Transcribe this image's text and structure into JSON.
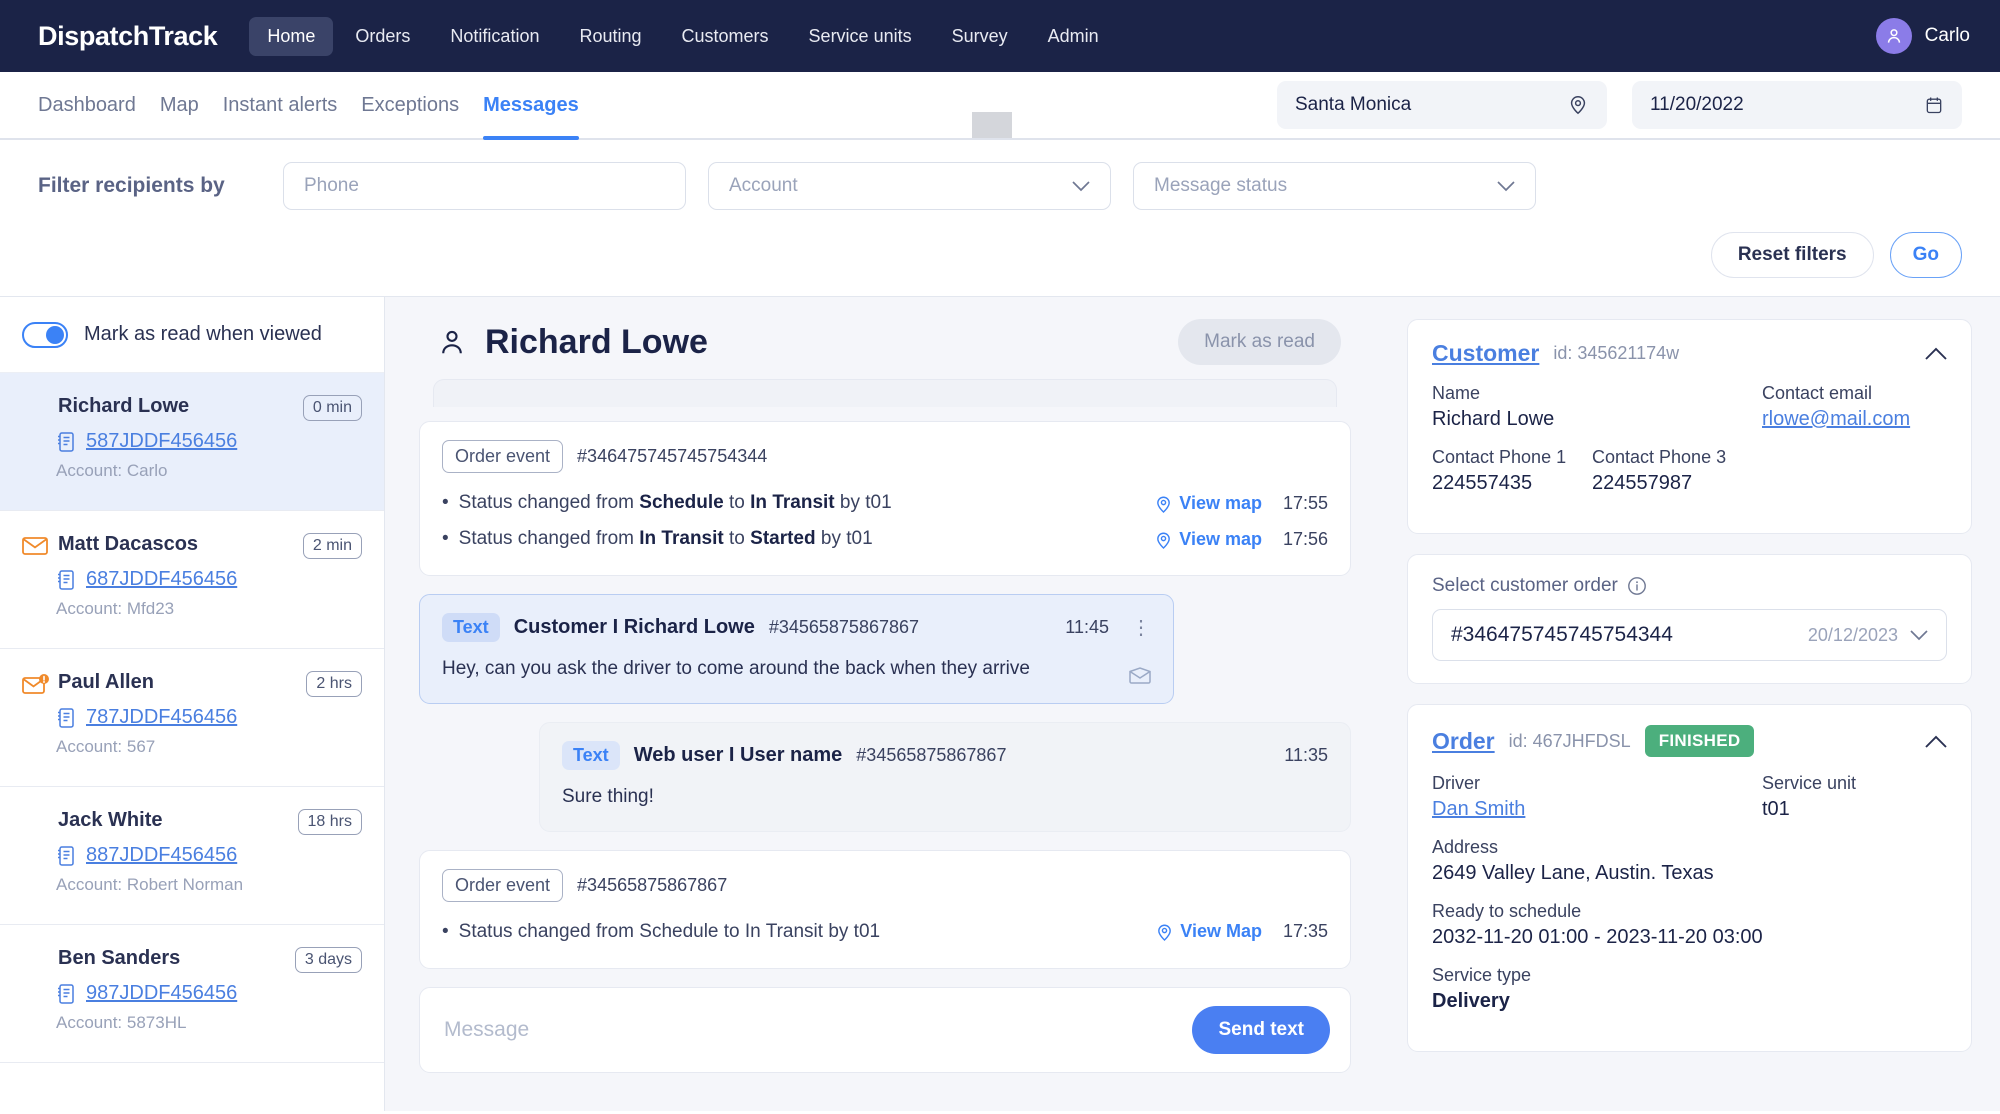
{
  "topnav": {
    "brand": "DispatchTrack",
    "links": [
      {
        "label": "Home",
        "active": true
      },
      {
        "label": "Orders",
        "active": false
      },
      {
        "label": "Notification",
        "active": false
      },
      {
        "label": "Routing",
        "active": false
      },
      {
        "label": "Customers",
        "active": false
      },
      {
        "label": "Service units",
        "active": false
      },
      {
        "label": "Survey",
        "active": false
      },
      {
        "label": "Admin",
        "active": false
      }
    ],
    "user": "Carlo"
  },
  "subnav": {
    "links": [
      {
        "label": "Dashboard",
        "active": false
      },
      {
        "label": "Map",
        "active": false
      },
      {
        "label": "Instant alerts",
        "active": false
      },
      {
        "label": "Exceptions",
        "active": false
      },
      {
        "label": "Messages",
        "active": true
      }
    ],
    "location_value": "Santa Monica",
    "date_value": "11/20/2022"
  },
  "filters": {
    "label": "Filter recipients by",
    "phone_placeholder": "Phone",
    "account_placeholder": "Account",
    "status_placeholder": "Message status",
    "reset_label": "Reset filters",
    "go_label": "Go"
  },
  "sidebar": {
    "mark_as_read_toggle_label": "Mark as read when viewed",
    "conversations": [
      {
        "name": "Richard Lowe",
        "time": "0 min",
        "order": "587JDDF456456",
        "account": "Account: Carlo",
        "selected": true,
        "icon": "none"
      },
      {
        "name": "Matt Dacascos",
        "time": "2 min",
        "order": "687JDDF456456",
        "account": "Account: Mfd23",
        "selected": false,
        "icon": "envelope"
      },
      {
        "name": "Paul Allen",
        "time": "2 hrs",
        "order": "787JDDF456456",
        "account": "Account: 567",
        "selected": false,
        "icon": "envelope-alert"
      },
      {
        "name": "Jack White",
        "time": "18 hrs",
        "order": "887JDDF456456",
        "account": "Account: Robert Norman",
        "selected": false,
        "icon": "none"
      },
      {
        "name": "Ben Sanders",
        "time": "3 days",
        "order": "987JDDF456456",
        "account": "Account: 5873HL",
        "selected": false,
        "icon": "none"
      }
    ]
  },
  "thread": {
    "title": "Richard Lowe",
    "mark_as_read_label": "Mark as read",
    "event1": {
      "badge": "Order event",
      "order_id": "#346475745745754344",
      "lines": [
        {
          "prefix": "Status changed from ",
          "from": "Schedule",
          "mid": " to ",
          "to": "In Transit",
          "suffix": " by t01",
          "bold": true,
          "link": "View map",
          "time": "17:55"
        },
        {
          "prefix": "Status changed from ",
          "from": "In Transit",
          "mid": " to ",
          "to": "Started",
          "suffix": " by t01",
          "bold": true,
          "link": "View map",
          "time": "17:56"
        }
      ]
    },
    "message_in": {
      "tag": "Text",
      "from": "Customer  I  Richard Lowe",
      "id": "#34565875867867",
      "time": "11:45",
      "body": "Hey, can you ask the driver to come around the back when they arrive"
    },
    "message_out": {
      "tag": "Text",
      "from": "Web user  I  User name",
      "id": "#34565875867867",
      "time": "11:35",
      "body": "Sure thing!"
    },
    "event2": {
      "badge": "Order event",
      "order_id": "#34565875867867",
      "lines": [
        {
          "prefix": "Status changed from ",
          "from": "Schedule",
          "mid": " to ",
          "to": "In Transit",
          "suffix": " by t01",
          "bold": false,
          "link": "View Map",
          "time": "17:35"
        }
      ]
    },
    "composer_placeholder": "Message",
    "send_label": "Send text"
  },
  "customer_panel": {
    "title": "Customer",
    "id": "id: 345621174w",
    "name_label": "Name",
    "name_value": "Richard Lowe",
    "email_label": "Contact email",
    "email_value": "rlowe@mail.com",
    "phone1_label": "Contact Phone 1",
    "phone1_value": "224557435",
    "phone3_label": "Contact Phone 3",
    "phone3_value": "224557987"
  },
  "order_select": {
    "label": "Select customer order",
    "value": "#346475745745754344",
    "date": "20/12/2023"
  },
  "order_panel": {
    "title": "Order",
    "id": "id: 467JHFDSL",
    "status": "FINISHED",
    "driver_label": "Driver",
    "driver_value": "Dan Smith",
    "unit_label": "Service unit",
    "unit_value": "t01",
    "address_label": "Address",
    "address_value": "2649 Valley Lane, Austin. Texas",
    "schedule_label": "Ready to schedule",
    "schedule_value": "2032-11-20 01:00 - 2023-11-20 03:00",
    "service_label": "Service type",
    "service_value": "Delivery"
  },
  "colors": {
    "nav_bg": "#1b2347",
    "accent": "#3b82f6",
    "status_green": "#4caf7d",
    "orange": "#f08a2b"
  }
}
